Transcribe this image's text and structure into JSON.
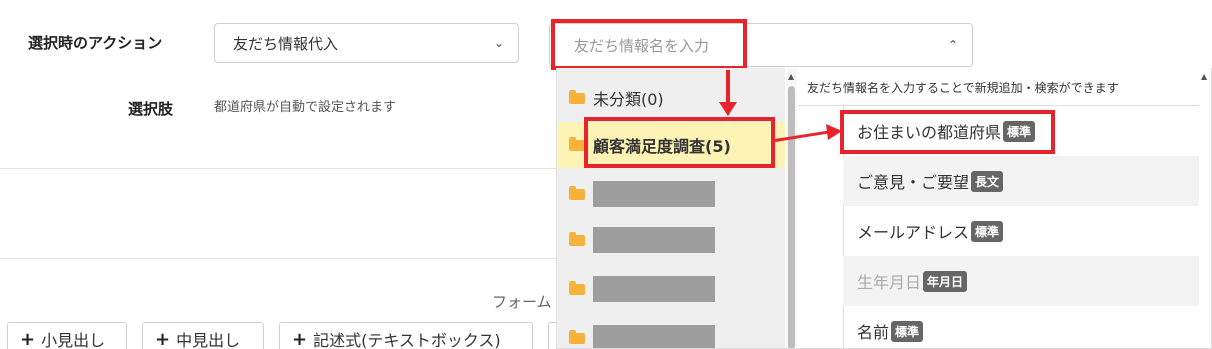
{
  "action": {
    "label": "選択時のアクション",
    "select_value": "友だち情報代入",
    "chevron": "chevron-down-icon"
  },
  "search": {
    "placeholder": "友だち情報名を入力",
    "chevron": "chevron-up-icon"
  },
  "choices": {
    "label": "選択肢",
    "helper": "都道府県が自動で設定されます"
  },
  "folders": [
    {
      "name": "未分類(0)",
      "selected": false
    },
    {
      "name": "顧客満足度調査(5)",
      "selected": true
    },
    {
      "name": "",
      "masked": true
    },
    {
      "name": "",
      "masked": true
    },
    {
      "name": "",
      "masked": true
    },
    {
      "name": "",
      "masked": true
    }
  ],
  "items_header": "友だち情報名を入力することで新規追加・検索ができます",
  "items": [
    {
      "name": "お住まいの都道府県",
      "badge": "標準"
    },
    {
      "name": "ご意見・ご要望",
      "badge": "長文"
    },
    {
      "name": "メールアドレス",
      "badge": "標準"
    },
    {
      "name": "生年月日",
      "badge": "年月日"
    },
    {
      "name": "名前",
      "badge": "標準"
    }
  ],
  "form_label": "フォーム",
  "buttons": [
    {
      "label": "小見出し"
    },
    {
      "label": "中見出し"
    },
    {
      "label": "記述式(テキストボックス)"
    }
  ],
  "colors": {
    "highlight": "#e8232b",
    "selected_folder": "#fdf3b5",
    "badge": "#666666"
  }
}
